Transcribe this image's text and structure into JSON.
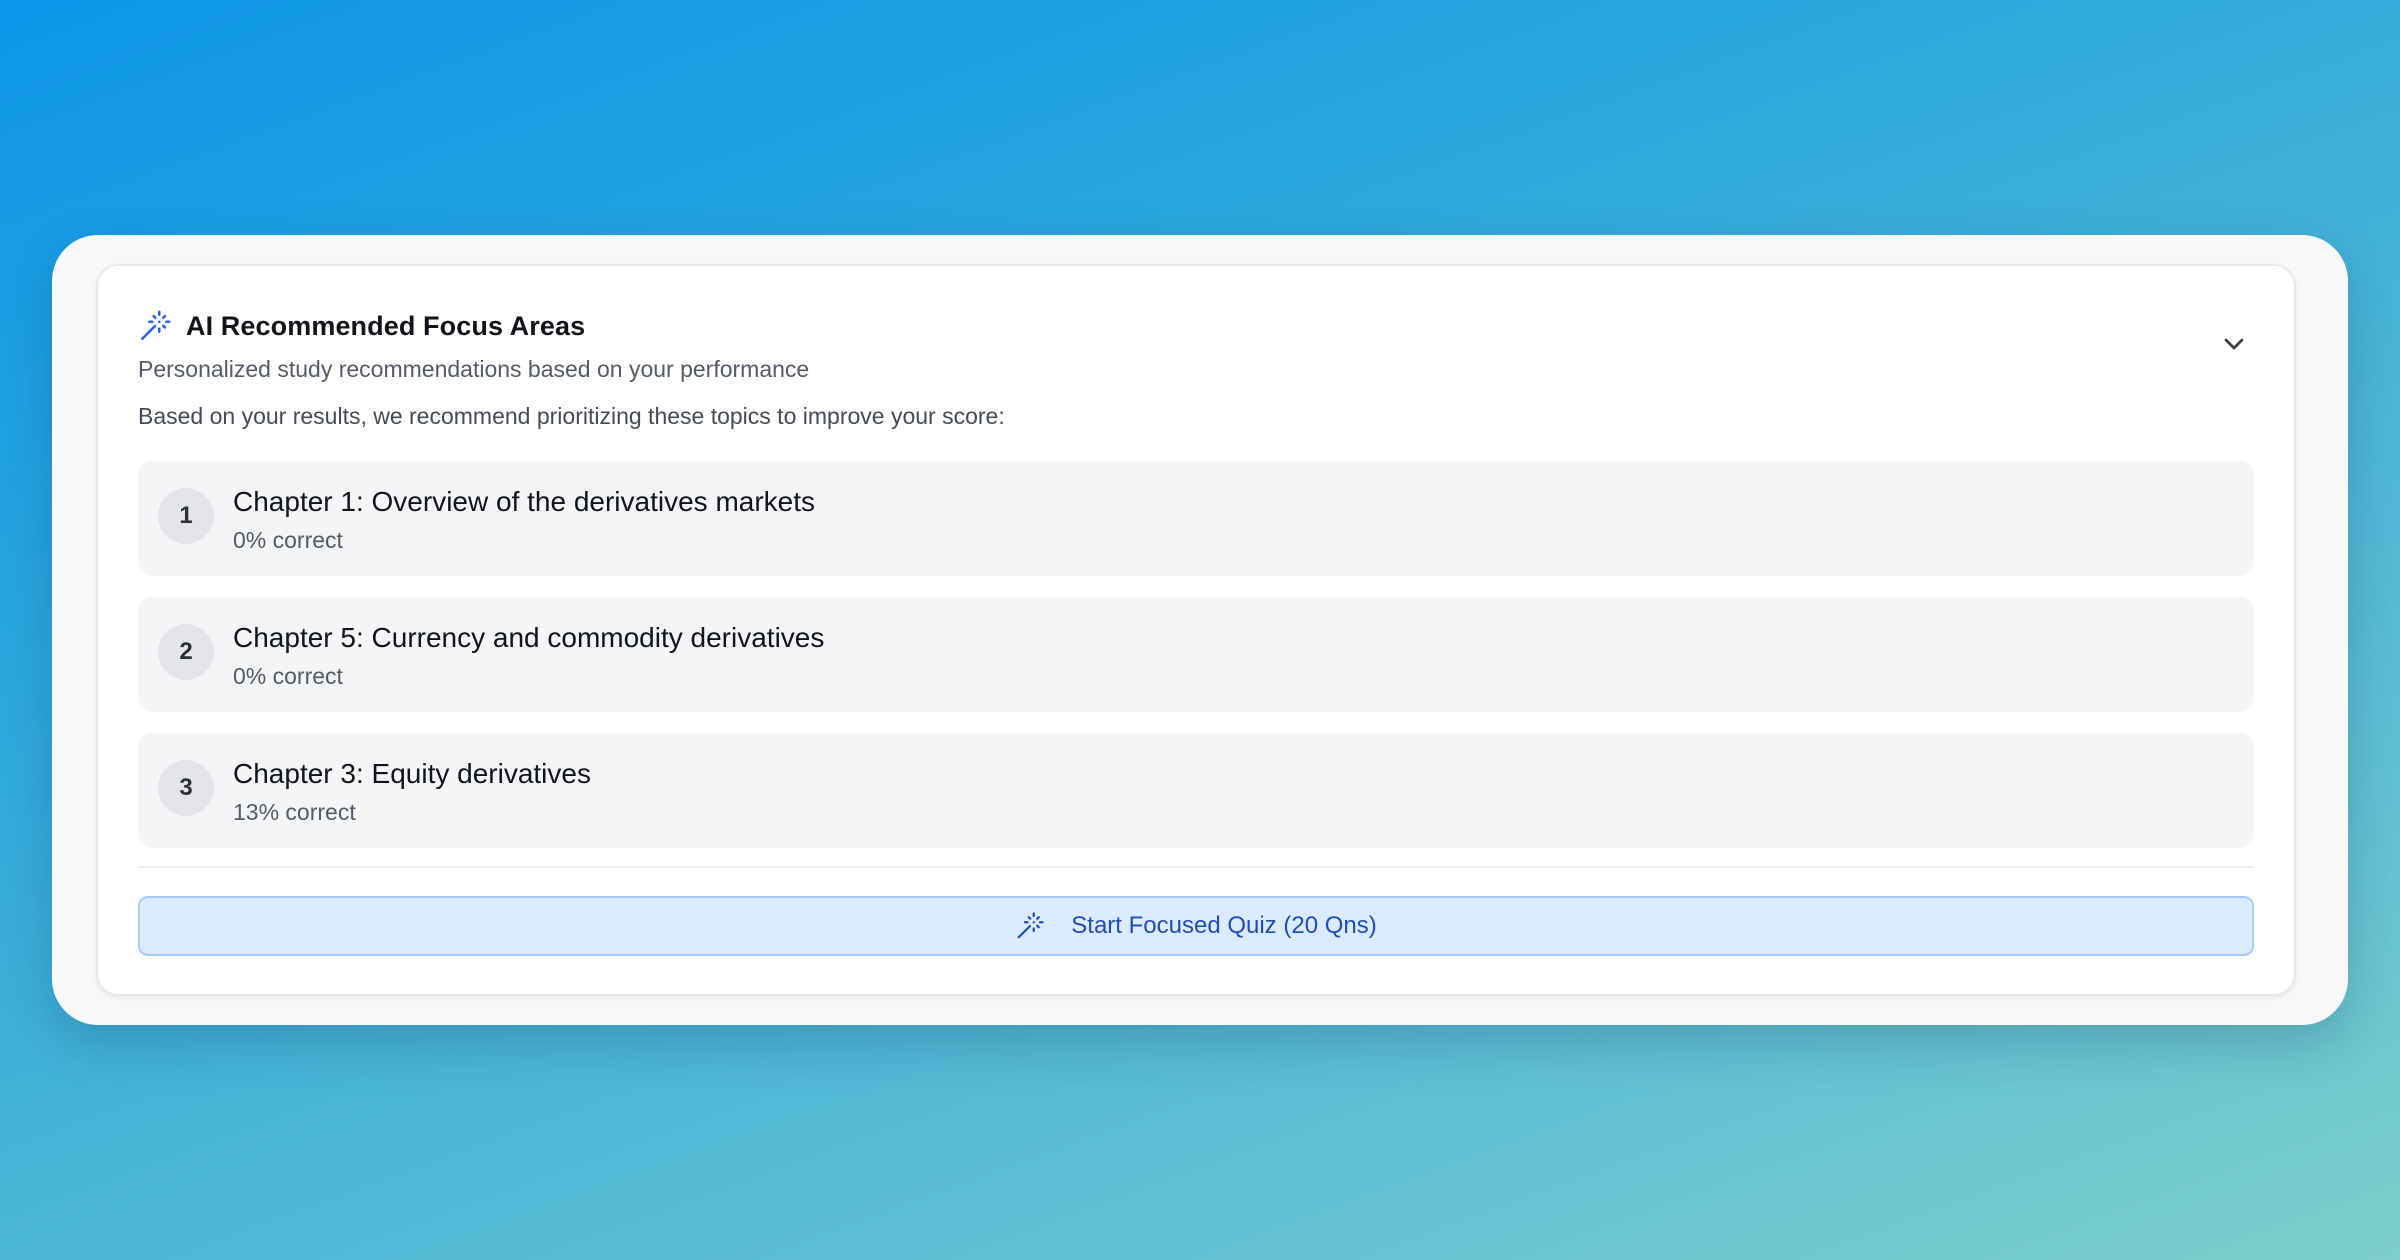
{
  "panel": {
    "title": "AI Recommended Focus Areas",
    "title_icon": "magic-wand-icon",
    "subtitle": "Personalized study recommendations based on your performance",
    "intro": "Based on your results, we recommend prioritizing these topics to improve your score:",
    "collapse_icon": "chevron-down-icon"
  },
  "topics": [
    {
      "rank": "1",
      "name": "Chapter 1: Overview of the derivatives markets",
      "score": "0% correct"
    },
    {
      "rank": "2",
      "name": "Chapter 5: Currency and commodity derivatives",
      "score": "0% correct"
    },
    {
      "rank": "3",
      "name": "Chapter 3: Equity derivatives",
      "score": "13% correct"
    }
  ],
  "quiz_button": {
    "label": "Start Focused Quiz (20 Qns)",
    "icon": "magic-wand-icon"
  },
  "colors": {
    "accent": "#2563eb",
    "button_bg": "#dbeafe",
    "button_text": "#1d4fb8",
    "item_bg": "#f4f5f7",
    "badge_bg": "#e3e5e9"
  }
}
